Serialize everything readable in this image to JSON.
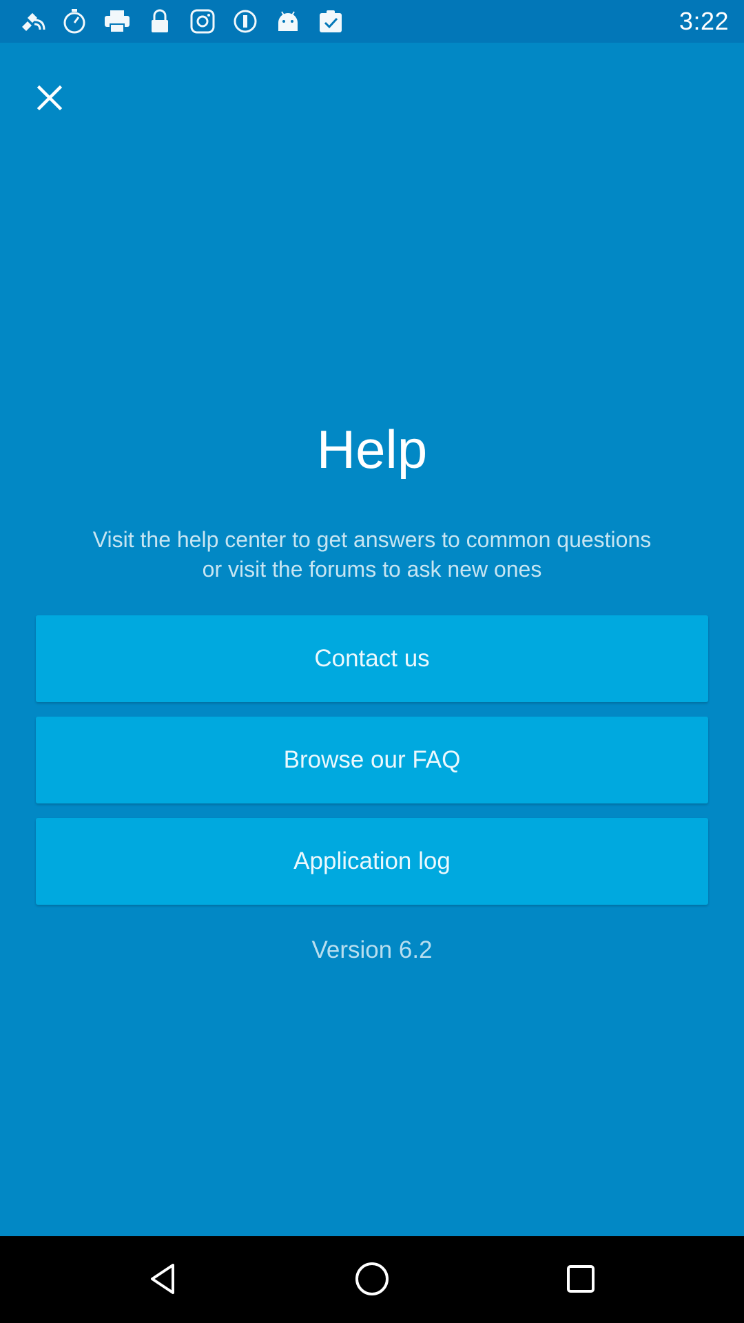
{
  "status_bar": {
    "time": "3:22",
    "icons": [
      "gps-satellite-icon",
      "stopwatch-icon",
      "printer-icon",
      "lock-icon",
      "instagram-icon",
      "onepassword-icon",
      "android-icon",
      "clipboard-check-icon"
    ]
  },
  "header": {
    "close_icon": "close-icon"
  },
  "help": {
    "title": "Help",
    "description": "Visit the help center to get answers to common questions or visit the forums to ask new ones"
  },
  "buttons": {
    "contact_label": "Contact us",
    "faq_label": "Browse our FAQ",
    "log_label": "Application log"
  },
  "footer": {
    "version": "Version 6.2"
  },
  "nav_bar": {
    "back_icon": "back-triangle-icon",
    "home_icon": "home-circle-icon",
    "recents_icon": "recents-square-icon"
  },
  "colors": {
    "background": "#0288c5",
    "status_bar": "#0277b8",
    "button": "#00a9df",
    "text": "#ffffff",
    "nav_bar": "#000000"
  }
}
